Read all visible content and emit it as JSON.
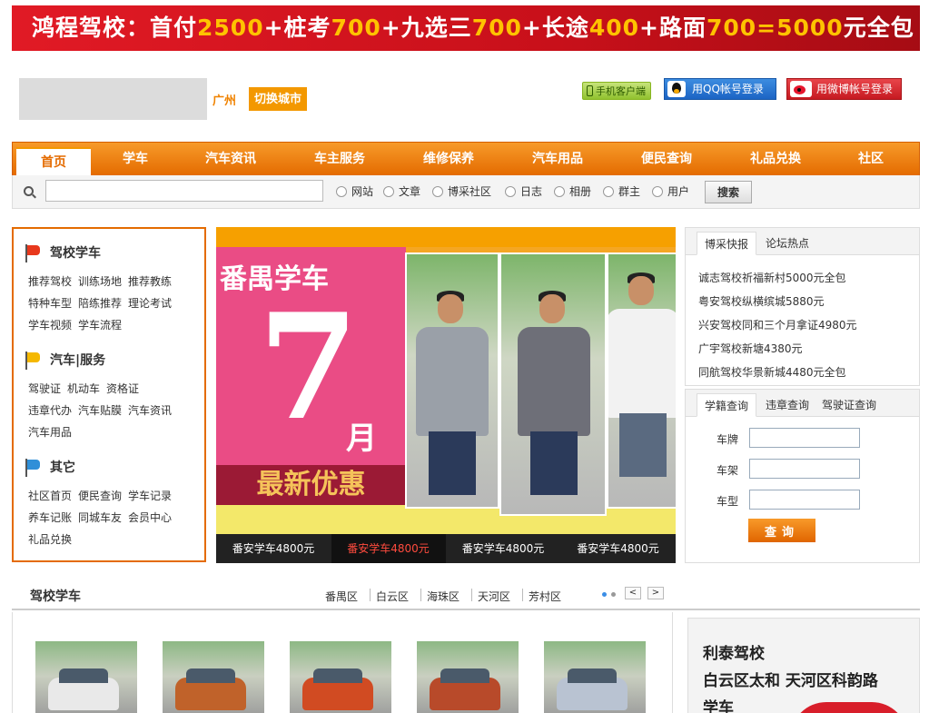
{
  "banner": {
    "parts": [
      {
        "text": "鸿程驾校：首付",
        "hl": false
      },
      {
        "text": "2500",
        "hl": true
      },
      {
        "text": "+桩考",
        "hl": false
      },
      {
        "text": "700",
        "hl": true
      },
      {
        "text": "+九选三",
        "hl": false
      },
      {
        "text": "700",
        "hl": true
      },
      {
        "text": "+长途",
        "hl": false
      },
      {
        "text": "400",
        "hl": true
      },
      {
        "text": "+路面",
        "hl": false
      },
      {
        "text": "700=5000",
        "hl": true
      },
      {
        "text": "元全包",
        "hl": false
      }
    ]
  },
  "header": {
    "city": "广州",
    "switch_city": "切换城市",
    "mobile_client": "手机客户端",
    "qq_login": "用QQ帐号登录",
    "weibo_login": "用微博帐号登录"
  },
  "nav": {
    "items": [
      "首页",
      "学车",
      "汽车资讯",
      "车主服务",
      "维修保养",
      "汽车用品",
      "便民查询",
      "礼品兑换",
      "社区"
    ],
    "active_index": 0
  },
  "search": {
    "placeholder": "",
    "options": [
      "网站",
      "文章",
      "博采社区",
      "日志",
      "相册",
      "群主",
      "用户"
    ],
    "button": "搜索"
  },
  "left_menu": {
    "groups": [
      {
        "title": "驾校学车",
        "flag": "red",
        "links": [
          "推荐驾校",
          "训练场地",
          "推荐教练",
          "特种车型",
          "陪练推荐",
          "理论考试",
          "学车视频",
          "学车流程"
        ]
      },
      {
        "title": "汽车|服务",
        "flag": "yellow",
        "links": [
          "驾驶证",
          "机动车",
          "资格证",
          "违章代办",
          "汽车贴膜",
          "汽车资讯",
          "汽车用品"
        ]
      },
      {
        "title": "其它",
        "flag": "blue",
        "links": [
          "社区首页",
          "便民查询",
          "学车记录",
          "养车记账",
          "同城车友",
          "会员中心",
          "礼品兑换"
        ]
      }
    ]
  },
  "promo": {
    "title": "番禺学车",
    "number": "7",
    "month": "月",
    "offer": "最新优惠",
    "tabs": [
      "番安学车4800元",
      "番安学车4800元",
      "番安学车4800元",
      "番安学车4800元"
    ],
    "active_tab": 1
  },
  "news_panel": {
    "tabs": [
      "博采快报",
      "论坛热点"
    ],
    "items": [
      "诚志驾校祈福新村5000元全包",
      "粤安驾校纵横缤城5880元",
      "兴安驾校同和三个月拿证4980元",
      "广宇驾校新塘4380元",
      "同航驾校华景新城4480元全包"
    ]
  },
  "query_panel": {
    "tabs": [
      "学籍查询",
      "违章查询",
      "驾驶证查询"
    ],
    "fields": [
      "车牌",
      "车架",
      "车型"
    ],
    "button": "查询"
  },
  "driving_schools": {
    "title": "驾校学车",
    "districts": [
      "番禺区",
      "白云区",
      "海珠区",
      "天河区",
      "芳村区"
    ],
    "prev": "<",
    "next": ">"
  },
  "ad": {
    "lines": [
      "利泰驾校",
      "白云区太和 天河区科韵路",
      "学车"
    ]
  },
  "colors": {
    "accent_orange": "#e46b00",
    "banner_red": "#d0121c",
    "highlight_yellow": "#ffc300"
  }
}
